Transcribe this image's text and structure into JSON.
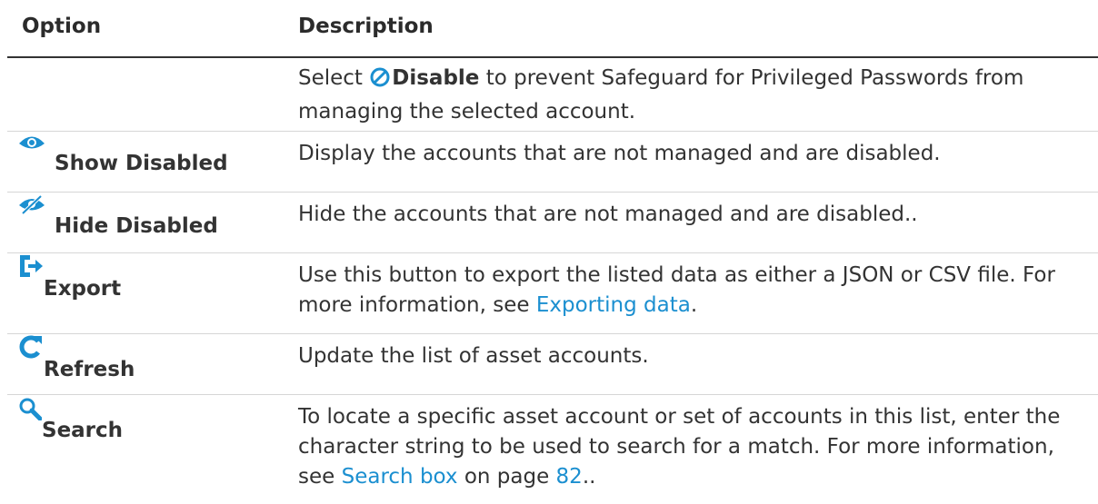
{
  "header": {
    "option": "Option",
    "description": "Description"
  },
  "rows": [
    {
      "option": "",
      "desc_pre": "Select ",
      "desc_bold": "Disable",
      "desc_post": " to prevent Safeguard for Privileged Passwords from managing the selected account.",
      "icon": "disable-icon"
    },
    {
      "option": "Show Disabled",
      "icon": "eye-icon",
      "desc": "Display the accounts that are not managed and are disabled."
    },
    {
      "option": "Hide Disabled",
      "icon": "eye-slash-icon",
      "desc": "Hide the accounts that are not managed and are disabled.."
    },
    {
      "option": "Export",
      "icon": "export-icon",
      "desc_pre": "Use this button to export the listed data as either a JSON or CSV file. For more information, see ",
      "link": "Exporting data",
      "desc_post": "."
    },
    {
      "option": "Refresh",
      "icon": "refresh-icon",
      "desc": "Update the list of asset accounts."
    },
    {
      "option": "Search",
      "icon": "search-icon",
      "desc_pre": "To locate a specific asset account or set of accounts in this list, enter the character string to be used to search for a match. For more information, see ",
      "link": "Search box",
      "desc_mid": " on page ",
      "page_link": "82",
      "desc_post": ".."
    }
  ],
  "colors": {
    "link": "#1b8fd0",
    "icon": "#1b8fd0",
    "text": "#333333"
  }
}
